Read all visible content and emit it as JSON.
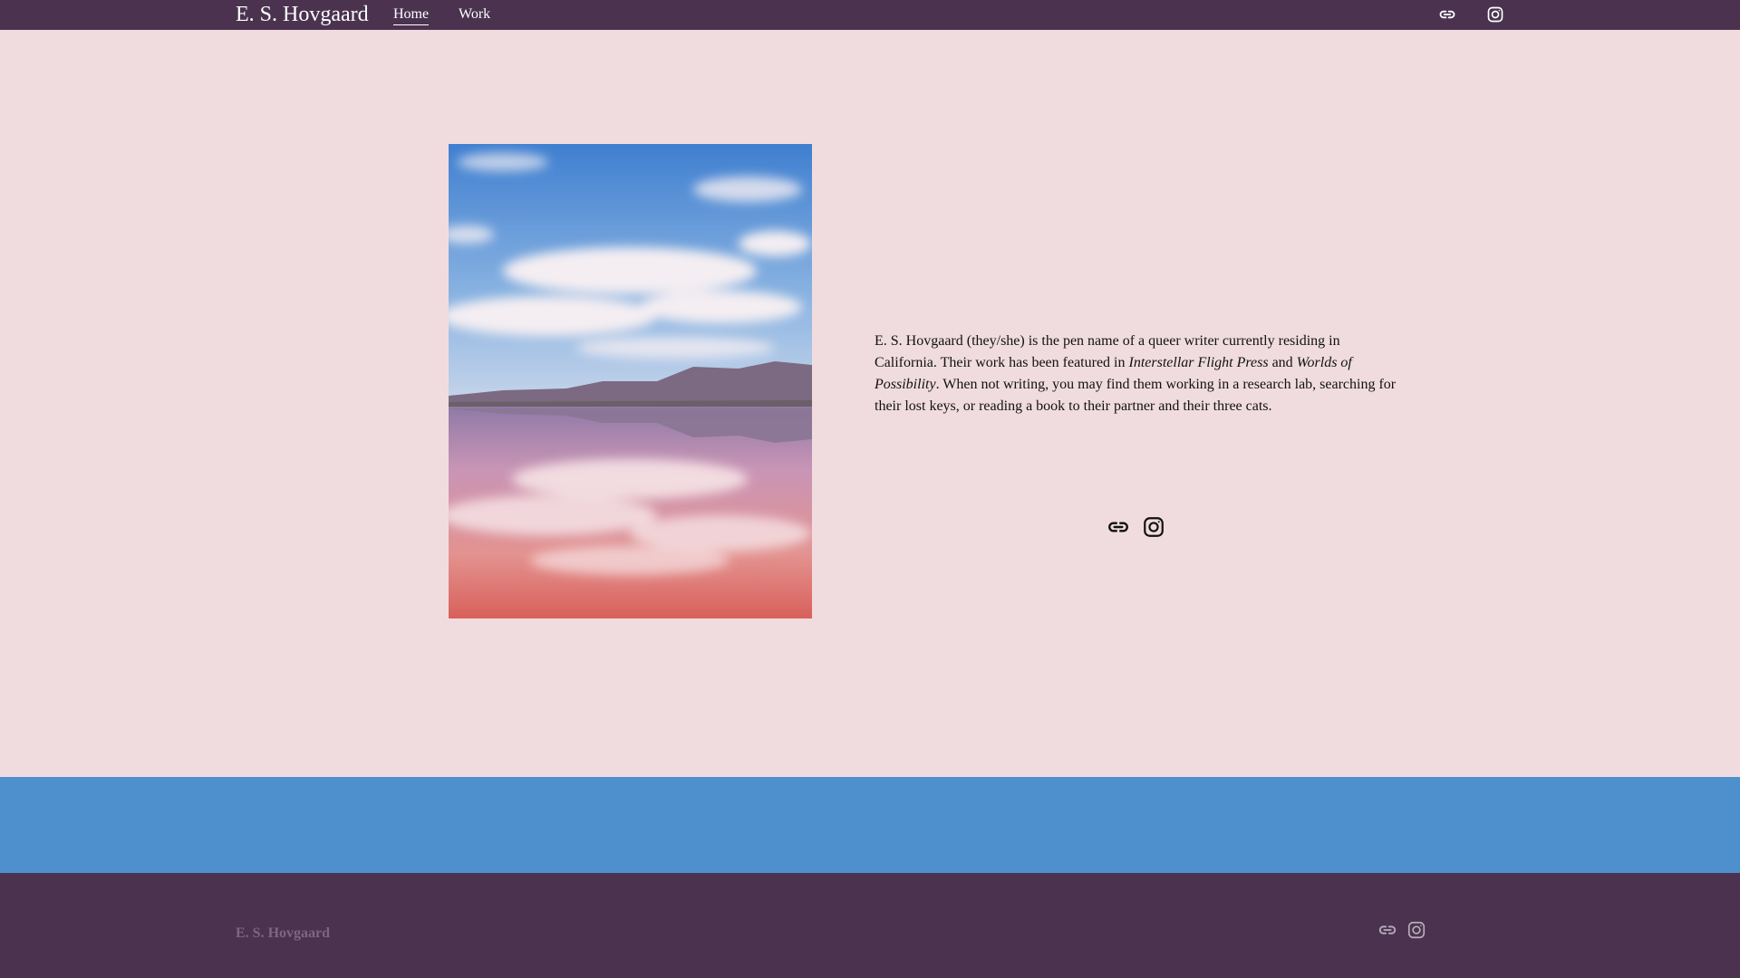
{
  "header": {
    "brand": "E. S. Hovgaard",
    "nav": [
      {
        "label": "Home",
        "active": true
      },
      {
        "label": "Work",
        "active": false
      }
    ],
    "icons": [
      "link-icon",
      "instagram-icon"
    ]
  },
  "main": {
    "image": {
      "icon": "landscape-reflection-photo"
    },
    "bio": {
      "part1": "E. S. Hovgaard (they/she) is the pen name of a queer writer currently residing in California. Their work has been featured in ",
      "pub1": "Interstellar Flight Press",
      "part2": " and ",
      "pub2": "Worlds of Possibility",
      "part3": ". When not writing, you may find them working in a research lab, searching for their lost keys, or reading a book to their partner and their three cats."
    },
    "icons": [
      "link-icon",
      "instagram-icon"
    ]
  },
  "footer": {
    "brand": "E. S. Hovgaard",
    "icons": [
      "link-icon",
      "instagram-icon"
    ]
  },
  "colors": {
    "header_bg": "#4b3350",
    "page_bg": "#f0dcdf",
    "band": "#4d90cd",
    "footer_text": "#7c6781"
  }
}
